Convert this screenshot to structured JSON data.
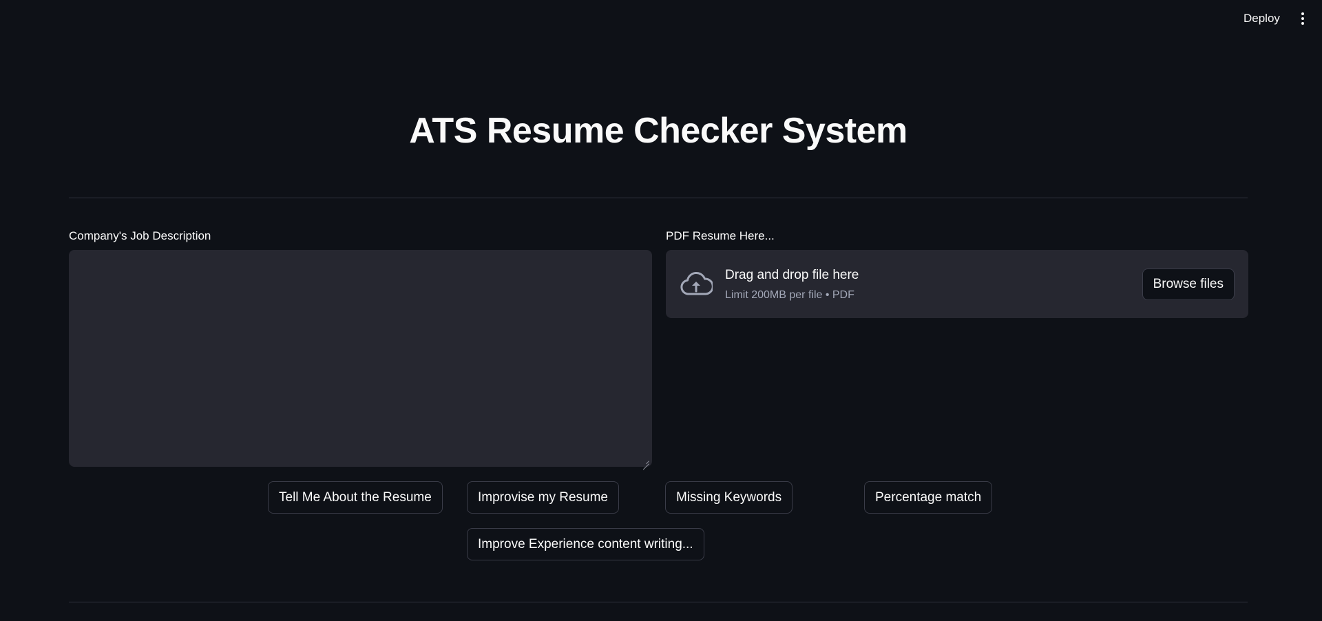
{
  "header": {
    "deploy_label": "Deploy",
    "menu_icon": "kebab-menu-icon"
  },
  "main": {
    "title": "ATS Resume Checker System",
    "job_description": {
      "label": "Company's Job Description",
      "value": ""
    },
    "uploader": {
      "label": "PDF Resume Here...",
      "icon": "cloud-upload-icon",
      "instruction": "Drag and drop file here",
      "limit_text": "Limit 200MB per file • PDF",
      "browse_label": "Browse files"
    },
    "actions": [
      {
        "label": "Tell Me About the Resume"
      },
      {
        "label": "Improvise my Resume"
      },
      {
        "label": "Missing Keywords"
      },
      {
        "label": "Percentage match"
      },
      {
        "label": "Improve Experience content writing..."
      }
    ]
  },
  "colors": {
    "background": "#0e1117",
    "surface": "#262730",
    "border": "#3a3c48",
    "text": "#fafafa",
    "muted_text": "#a3a8b8"
  }
}
